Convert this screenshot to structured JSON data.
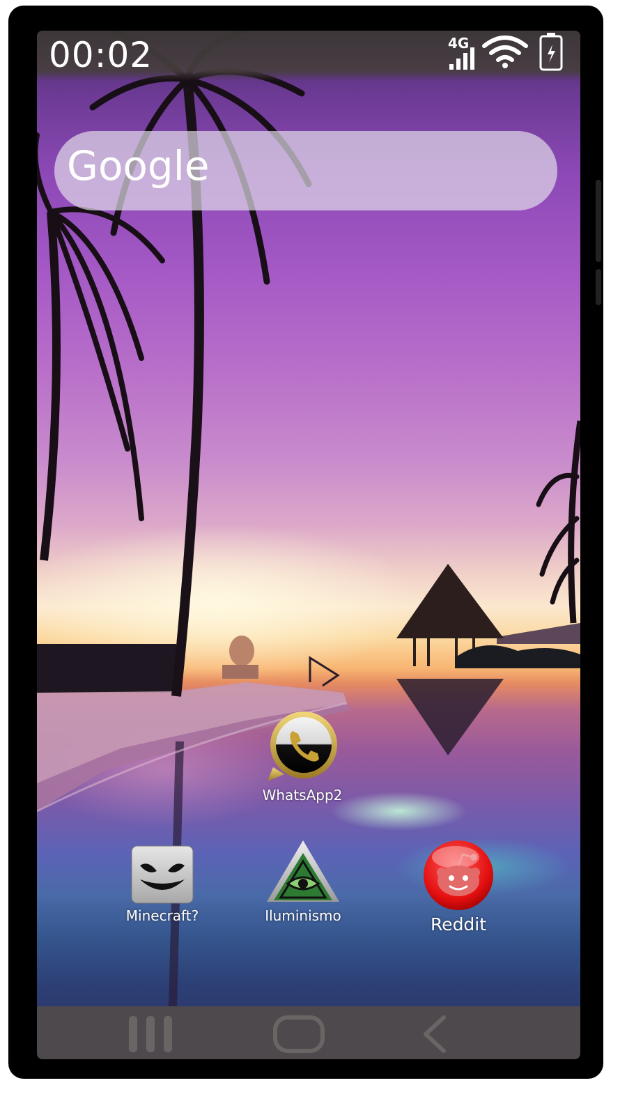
{
  "status_bar": {
    "time": "00:02",
    "network": "4G",
    "icons": [
      "signal-icon",
      "wifi-icon",
      "battery-charging-icon"
    ]
  },
  "search": {
    "label": "Google"
  },
  "apps": [
    {
      "label": "WhatsApp2",
      "icon": "whatsapp-icon"
    },
    {
      "label": "Minecraft?",
      "icon": "marshmello-icon"
    },
    {
      "label": "Iluminismo",
      "icon": "illuminati-eye-icon"
    },
    {
      "label": "Reddit",
      "icon": "reddit-icon"
    }
  ],
  "nav_bar": {
    "icons": [
      "recent-apps-icon",
      "home-icon",
      "back-icon"
    ]
  },
  "colors": {
    "search_bg": "#e1dce8",
    "status_bar_bg": "#3c3737",
    "nav_bar_bg": "#504b4b",
    "reddit_red": "#e41010",
    "whatsapp_gold": "#c9a236"
  }
}
